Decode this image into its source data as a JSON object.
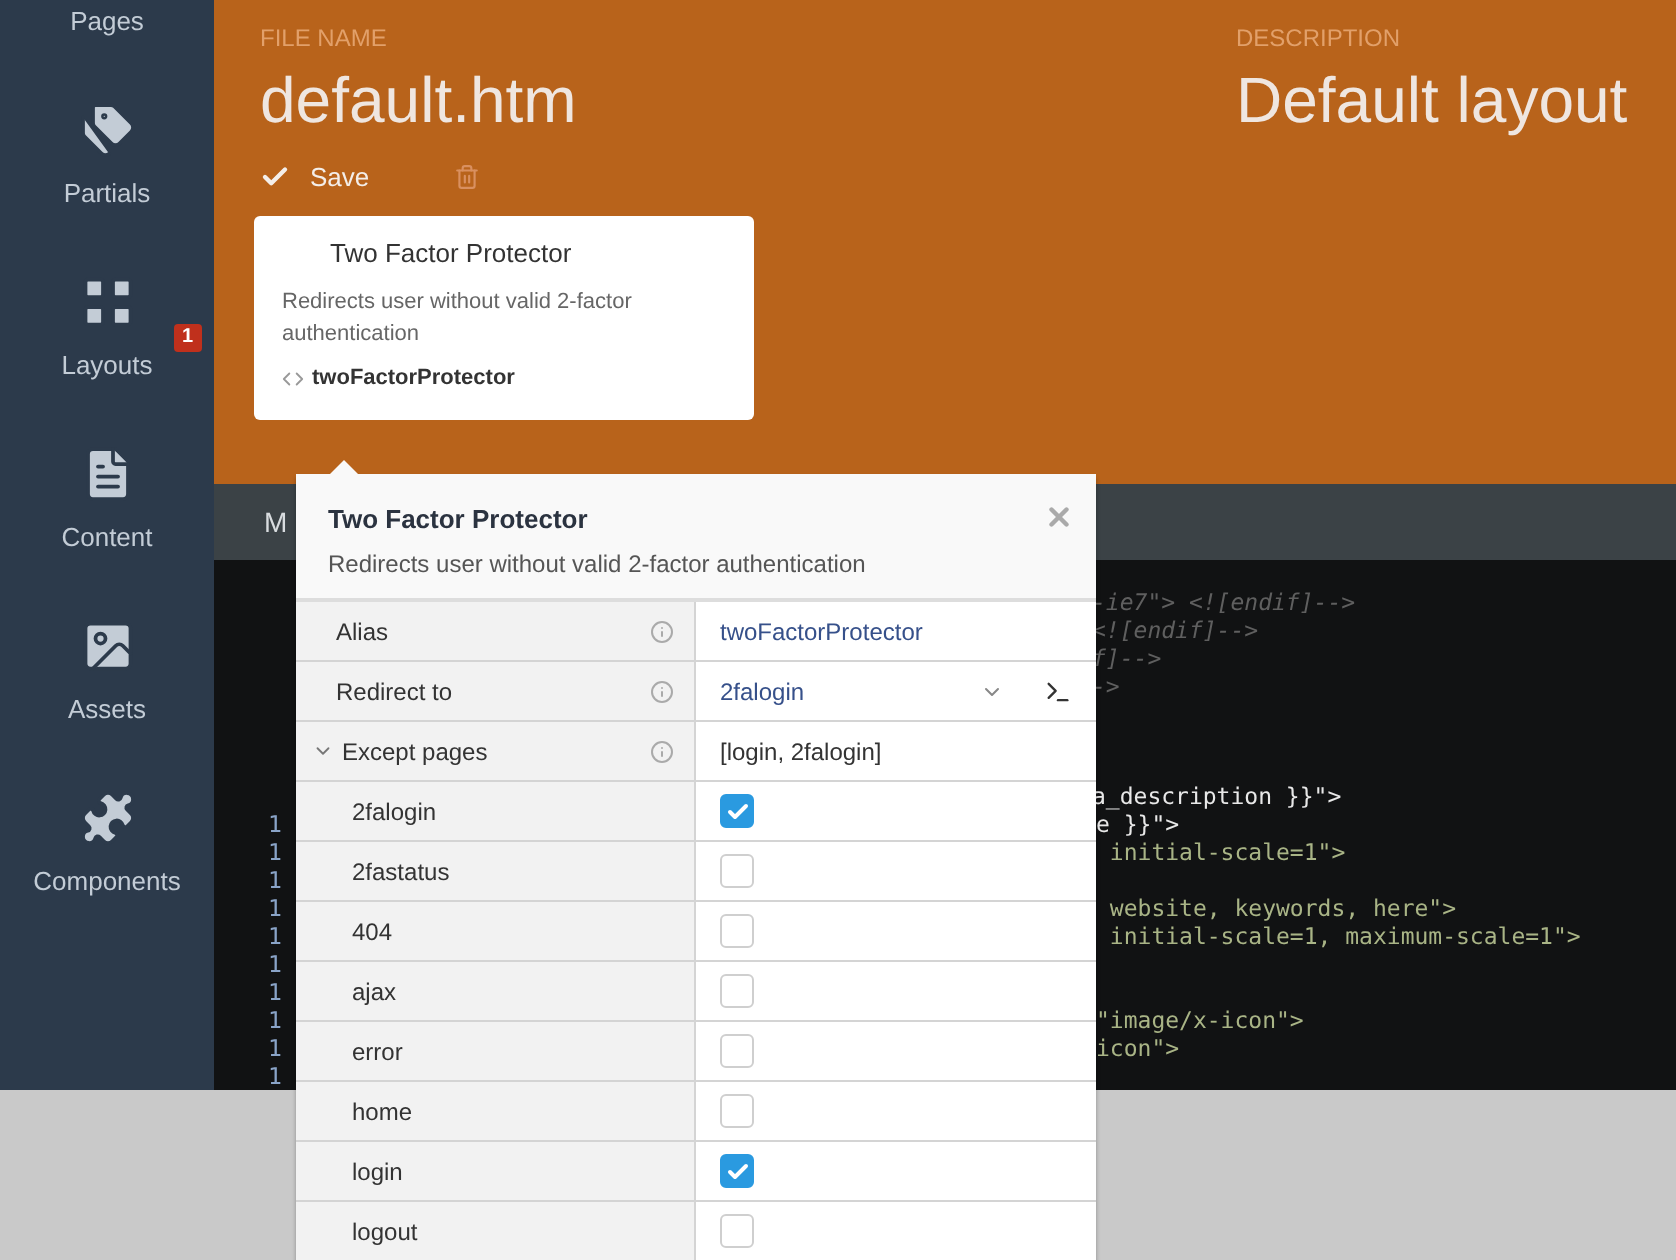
{
  "sidebar": {
    "items": [
      {
        "kind": "pages",
        "label": "Pages"
      },
      {
        "kind": "partials",
        "label": "Partials"
      },
      {
        "kind": "layouts",
        "label": "Layouts",
        "badge": "1"
      },
      {
        "kind": "content",
        "label": "Content"
      },
      {
        "kind": "assets",
        "label": "Assets"
      },
      {
        "kind": "components",
        "label": "Components"
      }
    ]
  },
  "header": {
    "file_name_label": "FILE NAME",
    "file_name": "default.htm",
    "description_label": "DESCRIPTION",
    "description": "Default layout",
    "save": "Save"
  },
  "component_card": {
    "title": "Two Factor Protector",
    "description": "Redirects user without valid 2-factor authentication",
    "alias": "twoFactorProtector"
  },
  "editor": {
    "tab": "M",
    "lines": [
      {
        "kind": "blank"
      },
      {
        "kind": "comment",
        "text": "-ie7\"> <![endif]-->"
      },
      {
        "kind": "comment",
        "text": "<![endif]-->"
      },
      {
        "kind": "comment",
        "text": "f]-->"
      },
      {
        "kind": "comment",
        "text": "->"
      },
      {
        "kind": "blank"
      },
      {
        "kind": "blank"
      },
      {
        "kind": "blank"
      },
      {
        "kind": "variable",
        "text": "a_description }}\">"
      },
      {
        "kind": "variable",
        "number": "1",
        "text": "e }}\">"
      },
      {
        "kind": "string",
        "number": "1",
        "text": " initial-scale=1\">"
      },
      {
        "kind": "blank",
        "number": "1"
      },
      {
        "kind": "string",
        "number": "1",
        "text": " website, keywords, here\">"
      },
      {
        "kind": "string",
        "number": "1",
        "text": " initial-scale=1, maximum-scale=1\">"
      },
      {
        "kind": "blank",
        "number": "1"
      },
      {
        "kind": "blank",
        "number": "1"
      },
      {
        "kind": "string",
        "number": "1",
        "text": "\"image/x-icon\">"
      },
      {
        "kind": "string",
        "number": "1",
        "text": "icon\">"
      },
      {
        "kind": "blank",
        "number": "1"
      }
    ]
  },
  "inspector": {
    "title": "Two Factor Protector",
    "description": "Redirects user without valid 2-factor authentication",
    "properties": [
      {
        "kind": "text",
        "label": "Alias",
        "value": "twoFactorProtector"
      },
      {
        "kind": "dropdown",
        "label": "Redirect to",
        "value": "2falogin"
      },
      {
        "kind": "set",
        "label": "Except pages",
        "value": "[login, 2falogin]",
        "expanded": true,
        "children": [
          {
            "label": "2falogin",
            "checked": true
          },
          {
            "label": "2fastatus",
            "checked": false
          },
          {
            "label": "404",
            "checked": false
          },
          {
            "label": "ajax",
            "checked": false
          },
          {
            "label": "error",
            "checked": false
          },
          {
            "label": "home",
            "checked": false
          },
          {
            "label": "login",
            "checked": true
          },
          {
            "label": "logout",
            "checked": false
          }
        ]
      }
    ]
  }
}
